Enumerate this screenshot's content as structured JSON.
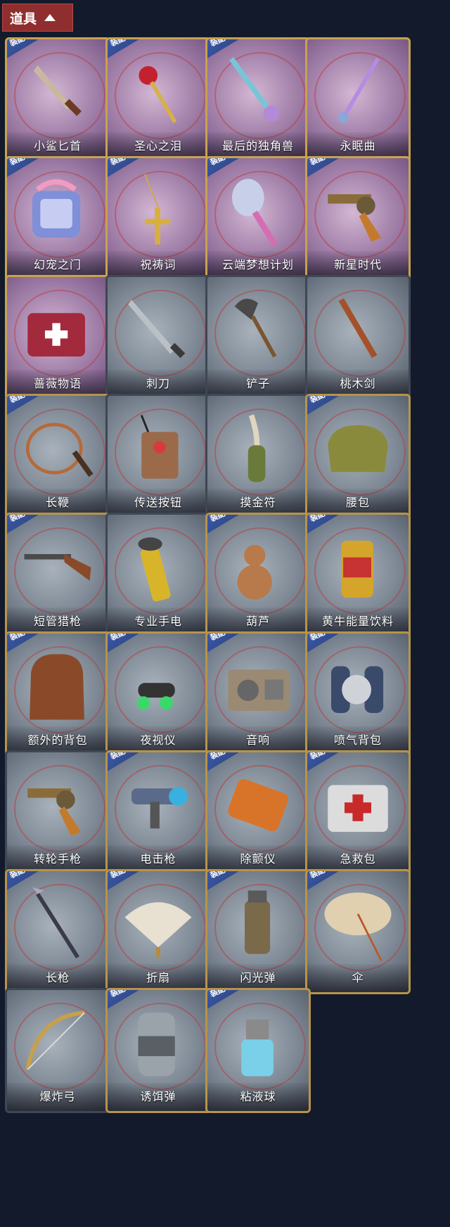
{
  "header": {
    "title": "道具"
  },
  "badge_text": "装配",
  "items": [
    {
      "name": "小鲨匕首",
      "rarity": "purple",
      "equipped": true,
      "icon": "dagger-icon"
    },
    {
      "name": "圣心之泪",
      "rarity": "purple",
      "equipped": true,
      "icon": "scepter-icon"
    },
    {
      "name": "最后的独角兽",
      "rarity": "purple",
      "equipped": true,
      "icon": "unicorn-sword-icon"
    },
    {
      "name": "永眠曲",
      "rarity": "purple",
      "equipped": false,
      "icon": "sword-icon"
    },
    {
      "name": "幻宠之门",
      "rarity": "purple",
      "equipped": true,
      "icon": "pet-gate-icon"
    },
    {
      "name": "祝祷词",
      "rarity": "purple",
      "equipped": true,
      "icon": "cross-icon"
    },
    {
      "name": "云端梦想计划",
      "rarity": "purple",
      "equipped": true,
      "icon": "dream-mace-icon"
    },
    {
      "name": "新星时代",
      "rarity": "purple",
      "equipped": true,
      "icon": "revolver-icon"
    },
    {
      "name": "蔷薇物语",
      "rarity": "purple",
      "equipped": false,
      "icon": "medkit-case-icon"
    },
    {
      "name": "刺刀",
      "rarity": "gray",
      "equipped": false,
      "icon": "bayonet-icon"
    },
    {
      "name": "铲子",
      "rarity": "gray",
      "equipped": false,
      "icon": "shovel-icon"
    },
    {
      "name": "桃木剑",
      "rarity": "gray",
      "equipped": false,
      "icon": "wood-sword-icon"
    },
    {
      "name": "长鞭",
      "rarity": "gray",
      "equipped": true,
      "icon": "whip-icon"
    },
    {
      "name": "传送按钮",
      "rarity": "gray",
      "equipped": false,
      "icon": "teleport-button-icon"
    },
    {
      "name": "摸金符",
      "rarity": "gray",
      "equipped": false,
      "icon": "talisman-icon"
    },
    {
      "name": "腰包",
      "rarity": "gray",
      "equipped": true,
      "icon": "waist-bag-icon"
    },
    {
      "name": "短管猎枪",
      "rarity": "gray",
      "equipped": true,
      "icon": "shotgun-icon"
    },
    {
      "name": "专业手电",
      "rarity": "gray",
      "equipped": false,
      "icon": "flashlight-icon"
    },
    {
      "name": "葫芦",
      "rarity": "gray",
      "equipped": true,
      "icon": "gourd-icon"
    },
    {
      "name": "黄牛能量饮料",
      "rarity": "gray",
      "equipped": true,
      "icon": "energy-drink-icon"
    },
    {
      "name": "额外的背包",
      "rarity": "gray",
      "equipped": true,
      "icon": "backpack-icon"
    },
    {
      "name": "夜视仪",
      "rarity": "gray",
      "equipped": true,
      "icon": "night-vision-icon"
    },
    {
      "name": "音响",
      "rarity": "gray",
      "equipped": true,
      "icon": "speaker-icon"
    },
    {
      "name": "喷气背包",
      "rarity": "gray",
      "equipped": true,
      "icon": "jetpack-icon"
    },
    {
      "name": "转轮手枪",
      "rarity": "gray",
      "equipped": false,
      "icon": "revolver-icon"
    },
    {
      "name": "电击枪",
      "rarity": "gray",
      "equipped": true,
      "icon": "shock-gun-icon"
    },
    {
      "name": "除颤仪",
      "rarity": "gray",
      "equipped": true,
      "icon": "defibrillator-icon"
    },
    {
      "name": "急救包",
      "rarity": "gray",
      "equipped": true,
      "icon": "first-aid-icon"
    },
    {
      "name": "长枪",
      "rarity": "gray",
      "equipped": true,
      "icon": "spear-icon"
    },
    {
      "name": "折扇",
      "rarity": "gray",
      "equipped": true,
      "icon": "fan-icon"
    },
    {
      "name": "闪光弹",
      "rarity": "gray",
      "equipped": true,
      "icon": "flashbang-icon"
    },
    {
      "name": "伞",
      "rarity": "gray",
      "equipped": true,
      "icon": "umbrella-icon"
    },
    {
      "name": "爆炸弓",
      "rarity": "gray",
      "equipped": false,
      "icon": "bow-icon"
    },
    {
      "name": "诱饵弹",
      "rarity": "gray",
      "equipped": true,
      "icon": "decoy-icon"
    },
    {
      "name": "粘液球",
      "rarity": "gray",
      "equipped": true,
      "icon": "slime-ball-icon"
    }
  ]
}
